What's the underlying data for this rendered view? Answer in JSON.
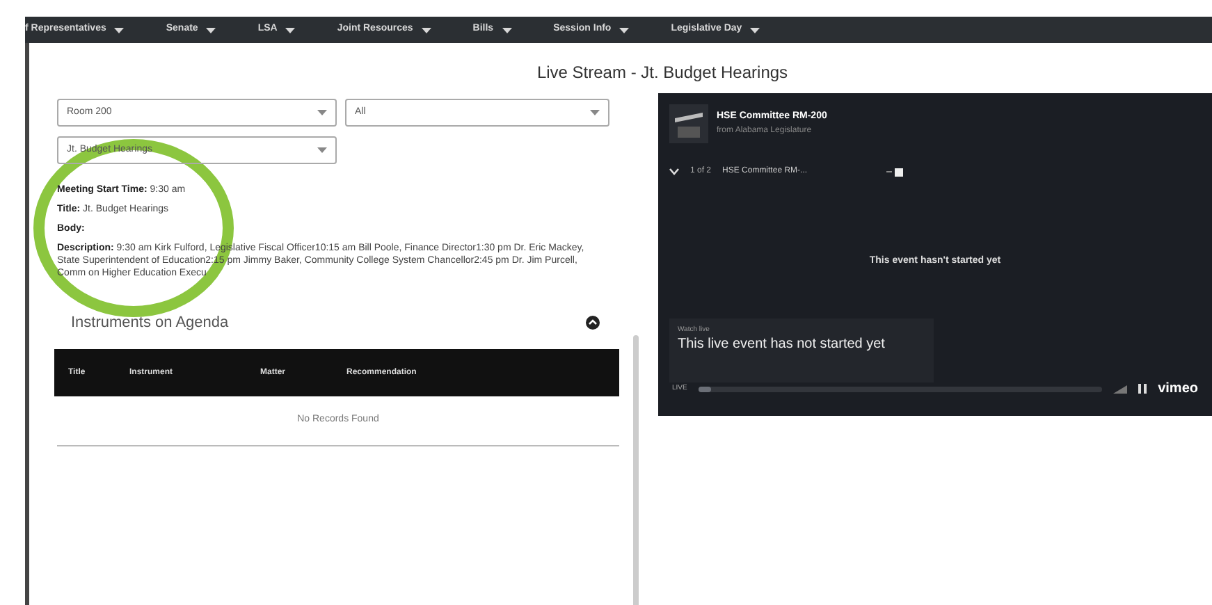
{
  "nav": {
    "items": [
      {
        "label": "f Representatives"
      },
      {
        "label": "Senate"
      },
      {
        "label": "LSA"
      },
      {
        "label": "Joint Resources"
      },
      {
        "label": "Bills"
      },
      {
        "label": "Session Info"
      },
      {
        "label": "Legislative Day"
      }
    ]
  },
  "page_title": "Live Stream - Jt. Budget Hearings",
  "filters": [
    {
      "value": "Room 200"
    },
    {
      "value": "All"
    },
    {
      "value": "Jt. Budget Hearings"
    }
  ],
  "meeting": [
    {
      "label": "Meeting Start Time:",
      "value": "9:30 am"
    },
    {
      "label": "Title:",
      "value": "Jt. Budget Hearings"
    },
    {
      "label": "Body:"
    },
    {
      "label": "Description:",
      "value": "9:30 am Kirk Fulford, Legislative Fiscal Officer10:15 am Bill Poole, Finance Director1:30 pm Dr. Eric Mackey, State Superintendent of Education2:15 pm Jimmy Baker, Community College System Chancellor2:45 pm Dr. Jim Purcell, Comm on Higher Education Execu"
    }
  ],
  "agenda": {
    "title": "Instruments on Agenda",
    "columns": [
      "Title",
      "Instrument",
      "Matter",
      "Recommendation"
    ],
    "empty_text": "No Records Found"
  },
  "player": {
    "channel": "HSE Committee RM-200",
    "source": "from Alabama Legislature",
    "position": "1 of 2",
    "playlist_item": "HSE Committee RM-...",
    "status": "This event hasn't started yet",
    "badge": "Watch live",
    "message": "This live event has not started yet",
    "time": "LIVE",
    "level": 0.03,
    "brand": "vimeo"
  }
}
